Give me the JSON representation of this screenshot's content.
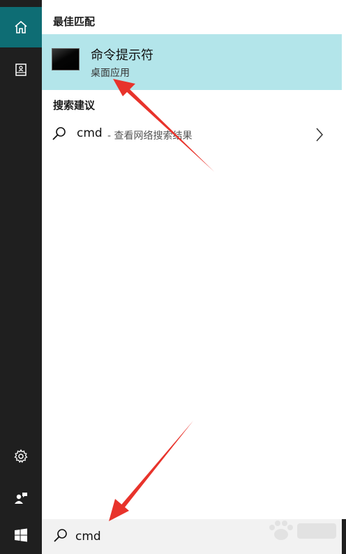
{
  "sidebar": {
    "items": [
      {
        "name": "home",
        "icon": "home-icon",
        "active": true
      },
      {
        "name": "notebook",
        "icon": "notebook-icon"
      },
      {
        "name": "settings",
        "icon": "gear-icon"
      },
      {
        "name": "feedback",
        "icon": "feedback-icon"
      },
      {
        "name": "start",
        "icon": "windows-icon"
      }
    ],
    "accent": "#0e6d74"
  },
  "results": {
    "best_match_header": "最佳匹配",
    "best_match": {
      "name": "命令提示符",
      "type": "桌面应用",
      "highlight": "#b3e5ea"
    },
    "suggestions_header": "搜索建议",
    "suggestions": [
      {
        "query": "cmd",
        "desc": "- 查看网络搜索结果"
      }
    ]
  },
  "search": {
    "value": "cmd"
  },
  "annotations": {
    "arrow_color": "#e8332b"
  }
}
